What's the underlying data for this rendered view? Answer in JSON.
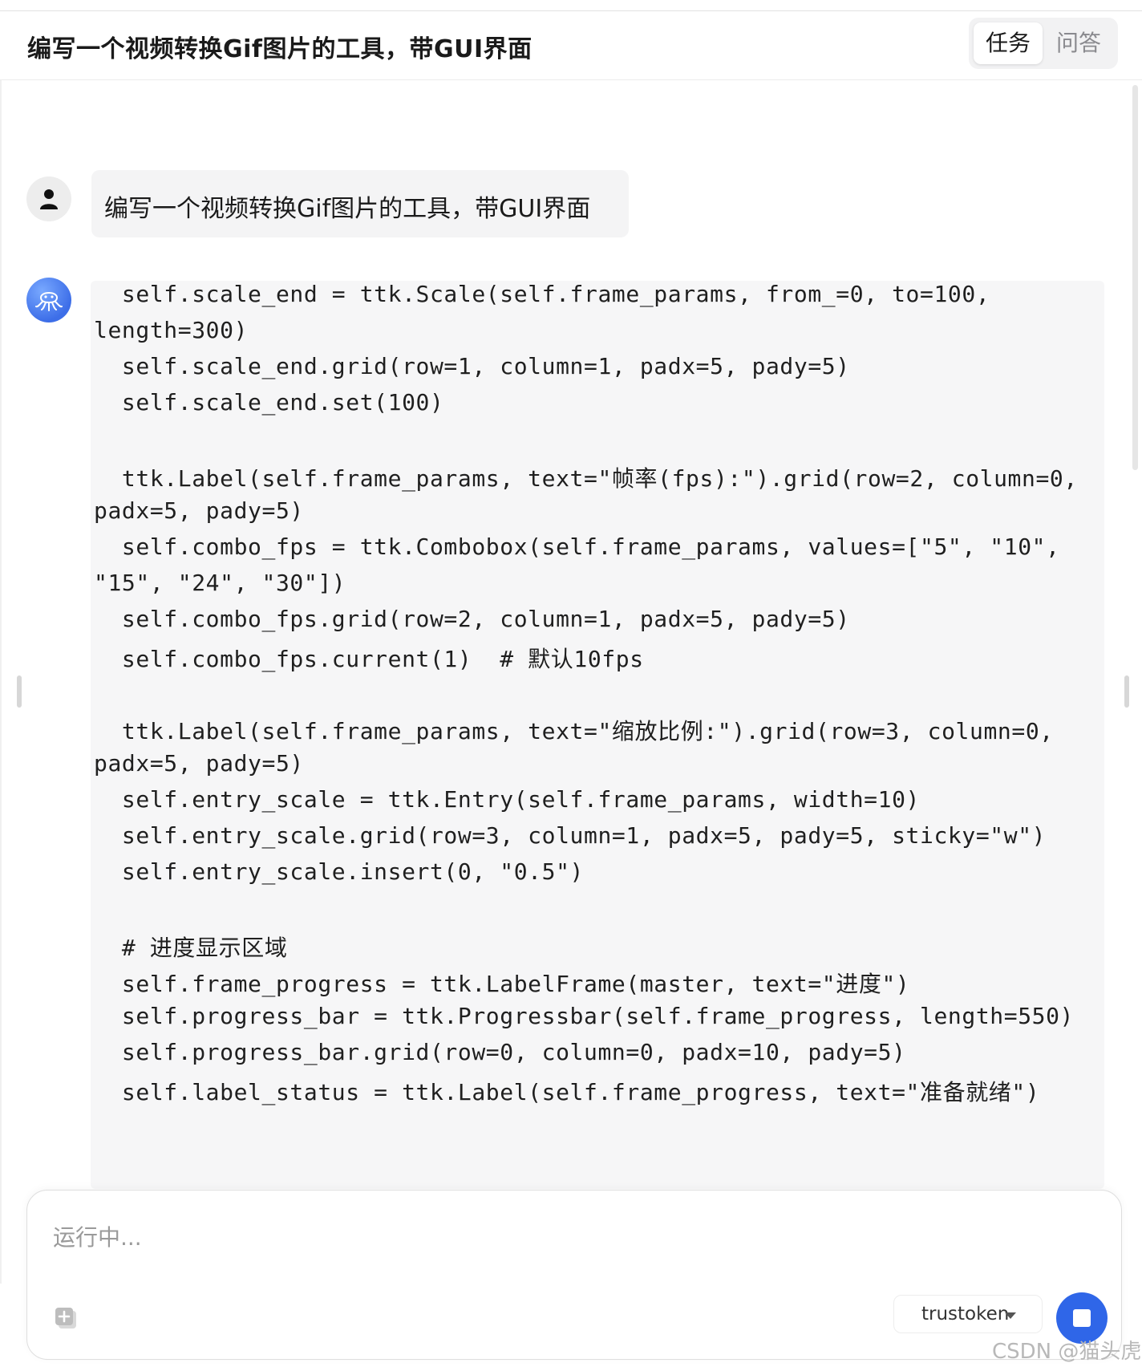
{
  "header": {
    "title": "编写一个视频转换Gif图片的工具，带GUI界面",
    "tabs": [
      {
        "label": "任务",
        "active": true
      },
      {
        "label": "问答",
        "active": false
      }
    ]
  },
  "conversation": {
    "user_message": "编写一个视频转换Gif图片的工具，带GUI界面",
    "code_lines": [
      "  self.scale_end = ttk.Scale(self.frame_params, from_=0, to=100,",
      "length=300)",
      "  self.scale_end.grid(row=1, column=1, padx=5, pady=5)",
      "  self.scale_end.set(100)",
      "",
      "  ttk.Label(self.frame_params, text=\"帧率(fps):\").grid(row=2, column=0,",
      "padx=5, pady=5)",
      "  self.combo_fps = ttk.Combobox(self.frame_params, values=[\"5\", \"10\",",
      "\"15\", \"24\", \"30\"])",
      "  self.combo_fps.grid(row=2, column=1, padx=5, pady=5)",
      "  self.combo_fps.current(1)  # 默认10fps",
      "",
      "  ttk.Label(self.frame_params, text=\"缩放比例:\").grid(row=3, column=0,",
      "padx=5, pady=5)",
      "  self.entry_scale = ttk.Entry(self.frame_params, width=10)",
      "  self.entry_scale.grid(row=3, column=1, padx=5, pady=5, sticky=\"w\")",
      "  self.entry_scale.insert(0, \"0.5\")",
      "",
      "  # 进度显示区域",
      "  self.frame_progress = ttk.LabelFrame(master, text=\"进度\")",
      "  self.progress_bar = ttk.Progressbar(self.frame_progress, length=550)",
      "  self.progress_bar.grid(row=0, column=0, padx=10, pady=5)",
      "  self.label_status = ttk.Label(self.frame_progress, text=\"准备就绪\")"
    ]
  },
  "composer": {
    "placeholder": "运行中...",
    "value": "",
    "model": "trustoken"
  },
  "icons": {
    "user_avatar": "user-icon",
    "assistant_avatar": "octopus-icon",
    "attach": "add-attachment-icon",
    "stop": "stop-icon",
    "caret": "caret-down-icon"
  },
  "colors": {
    "accent": "#2f66e8",
    "code_background": "#f6f6f7",
    "bubble_background": "#f4f4f5"
  },
  "watermark": "CSDN @猫头虎"
}
